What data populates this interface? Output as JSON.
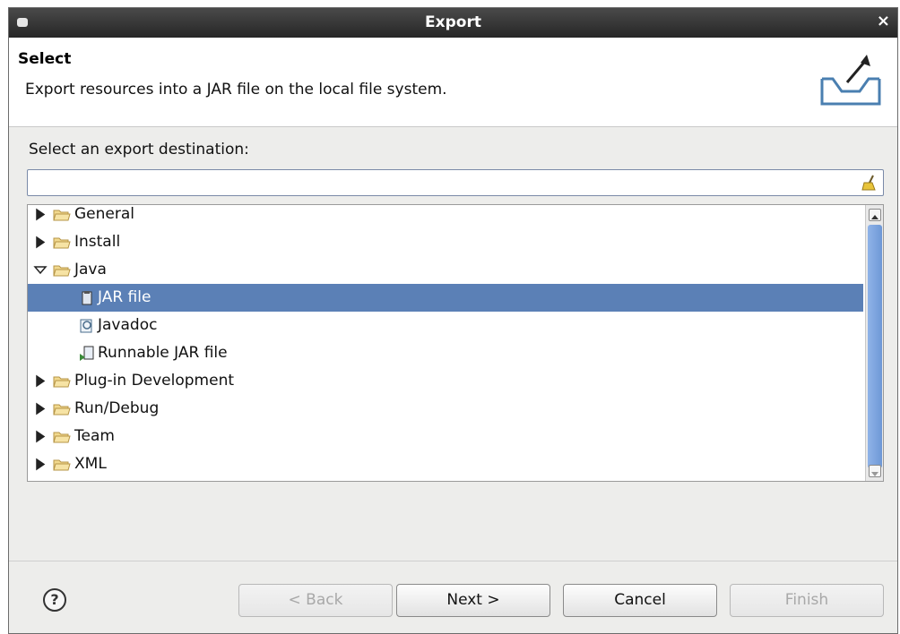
{
  "window": {
    "title": "Export",
    "close_glyph": "×"
  },
  "banner": {
    "heading": "Select",
    "description": "Export resources into a JAR file on the local file system.",
    "graphic_icon": "export-wizard-icon"
  },
  "destination": {
    "label": "Select an export destination:",
    "filter_value": "",
    "filter_placeholder": "",
    "clear_icon": "clear-filter-icon"
  },
  "tree": {
    "items": [
      {
        "label": "General",
        "level": 0,
        "expanded": false,
        "icon": "folder-icon",
        "selected": false
      },
      {
        "label": "Install",
        "level": 0,
        "expanded": false,
        "icon": "folder-icon",
        "selected": false
      },
      {
        "label": "Java",
        "level": 0,
        "expanded": true,
        "icon": "folder-icon",
        "selected": false
      },
      {
        "label": "JAR file",
        "level": 1,
        "icon": "jar-file-icon",
        "selected": true
      },
      {
        "label": "Javadoc",
        "level": 1,
        "icon": "javadoc-icon",
        "selected": false
      },
      {
        "label": "Runnable JAR file",
        "level": 1,
        "icon": "runnable-jar-icon",
        "selected": false
      },
      {
        "label": "Plug-in Development",
        "level": 0,
        "expanded": false,
        "icon": "folder-icon",
        "selected": false
      },
      {
        "label": "Run/Debug",
        "level": 0,
        "expanded": false,
        "icon": "folder-icon",
        "selected": false
      },
      {
        "label": "Team",
        "level": 0,
        "expanded": false,
        "icon": "folder-icon",
        "selected": false
      },
      {
        "label": "XML",
        "level": 0,
        "expanded": false,
        "icon": "folder-icon",
        "selected": false
      }
    ]
  },
  "footer": {
    "help_glyph": "?",
    "back_label": "< Back",
    "next_label": "Next >",
    "cancel_label": "Cancel",
    "finish_label": "Finish"
  },
  "colors": {
    "selection": "#5b80b6",
    "titlebar": "#2f2f2f",
    "folder": "#e8c97a"
  }
}
